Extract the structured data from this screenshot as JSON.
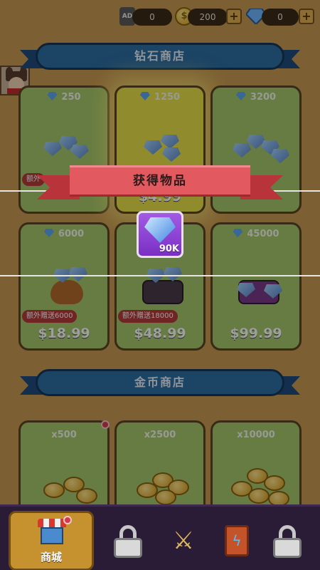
{
  "topbar": {
    "ad_label": "AD",
    "ad_value": "0",
    "coins": "200",
    "gems": "0",
    "plus_label": "+"
  },
  "shops": {
    "diamond_title": "钻石商店",
    "gold_title": "金币商店"
  },
  "diamond_cards": [
    {
      "amount": "250",
      "bonus": "额外",
      "price": ""
    },
    {
      "amount": "1250",
      "bonus": "",
      "price": "$4.99"
    },
    {
      "amount": "3200",
      "bonus": "",
      "price": ""
    },
    {
      "amount": "6000",
      "bonus": "额外赠送6000",
      "price": "$18.99"
    },
    {
      "amount": "",
      "bonus": "额外赠送18000",
      "price": "$48.99"
    },
    {
      "amount": "45000",
      "bonus": "",
      "price": "$99.99"
    }
  ],
  "gold_cards": [
    {
      "amount": "x500"
    },
    {
      "amount": "x2500"
    },
    {
      "amount": "x10000"
    }
  ],
  "popup": {
    "title": "获得物品",
    "reward_amount": "90K",
    "reward_icon": "diamond-icon"
  },
  "nav": {
    "shop_label": "商城",
    "items": [
      "shop",
      "locked",
      "battle",
      "book",
      "locked"
    ]
  },
  "colors": {
    "popup_ribbon": "#e25a60",
    "reward_bg": "#8e43d6",
    "shop_banner": "#2c6ea3",
    "card_green": "#a6c86b",
    "nav_active": "#c6922f"
  }
}
